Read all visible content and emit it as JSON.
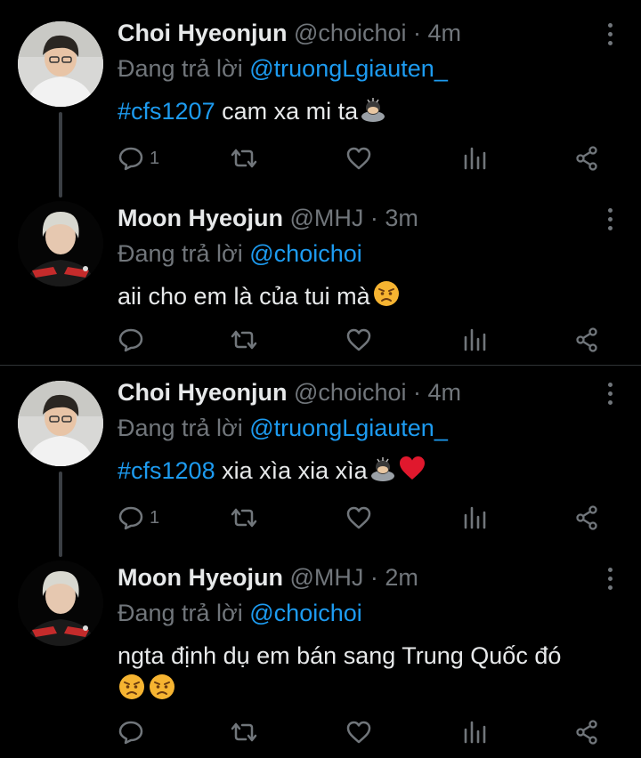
{
  "tweets": [
    {
      "name": "Choi Hyeonjun",
      "handle": "@choichoi",
      "time": "4m",
      "reply_prefix": "Đang trả lời ",
      "reply_to": "@truongLgiauten_",
      "hashtag": "#cfs1207",
      "text": " cam xa mi ta",
      "emojis": [
        "person-bowing-emoji"
      ],
      "reply_count": "1"
    },
    {
      "name": "Moon Hyeojun",
      "handle": "@MHJ",
      "time": "3m",
      "reply_prefix": "Đang trả lời ",
      "reply_to": "@choichoi",
      "text": "aii cho em là của tui mà",
      "emojis": [
        "angry-face-emoji"
      ],
      "reply_count": ""
    },
    {
      "name": "Choi Hyeonjun",
      "handle": "@choichoi",
      "time": "4m",
      "reply_prefix": "Đang trả lời ",
      "reply_to": "@truongLgiauten_",
      "hashtag": "#cfs1208",
      "text": " xia xìa xia xìa",
      "emojis": [
        "person-bowing-emoji",
        "red-heart-emoji"
      ],
      "reply_count": "1"
    },
    {
      "name": "Moon Hyeojun",
      "handle": "@MHJ",
      "time": "2m",
      "reply_prefix": "Đang trả lời ",
      "reply_to": "@choichoi",
      "text": "ngta định dụ em bán sang Trung Quốc đó",
      "emojis": [
        "angry-face-emoji",
        "angry-face-emoji"
      ],
      "reply_count": ""
    }
  ],
  "separator": " · ",
  "icons": [
    "reply-icon",
    "retweet-icon",
    "like-icon",
    "analytics-icon",
    "share-icon",
    "more-icon"
  ],
  "colors": {
    "accent": "#1d9bf0",
    "muted": "#71767b",
    "text": "#e7e9ea",
    "background": "#000000"
  }
}
